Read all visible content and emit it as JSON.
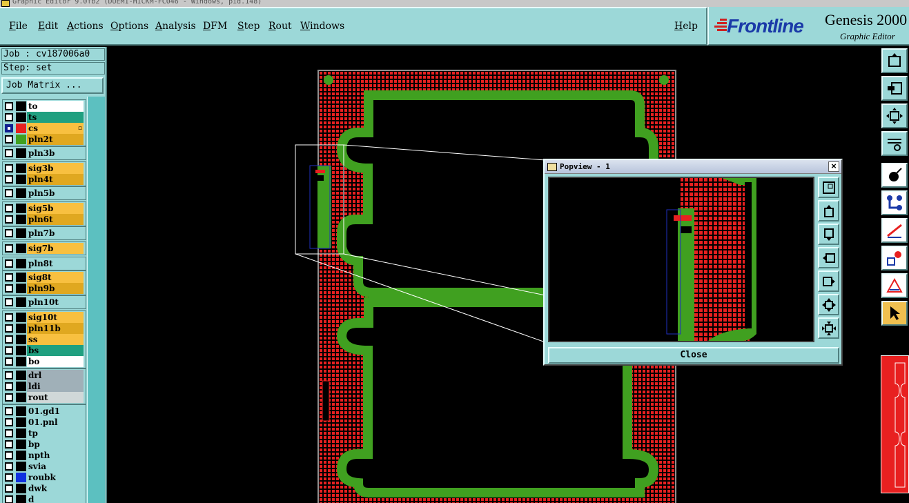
{
  "title_bar": {
    "text": "Graphic Editor 9.0fb2 (DUEM1-HICKM-FC046 - Windows, pid.148)"
  },
  "menu": {
    "items": [
      "File",
      "Edit",
      "Actions",
      "Options",
      "Analysis",
      "DFM",
      "Step",
      "Rout",
      "Windows"
    ],
    "help": "Help"
  },
  "branding": {
    "logo": "Frontline",
    "product": "Genesis 2000",
    "subtitle": "Graphic Editor"
  },
  "job": {
    "job_label": "Job : cv187006a0",
    "step_label": "Step: set",
    "matrix_button": "Job Matrix ..."
  },
  "layers": [
    {
      "name": "to",
      "color": "#ffffff",
      "swatch": "#000000",
      "checked": false
    },
    {
      "name": "ts",
      "color": "#20a080",
      "swatch": "#000000",
      "checked": false
    },
    {
      "name": "cs",
      "color": "#f8c040",
      "swatch": "#e82020",
      "checked": true,
      "marker": "▫"
    },
    {
      "name": "pln2t",
      "color": "#e0a820",
      "swatch": "#40a020",
      "checked": false
    },
    {
      "name": "pln3b",
      "color": "#9cd8d8",
      "swatch": "#000000",
      "checked": false
    },
    {
      "name": "sig3b",
      "color": "#f8c040",
      "swatch": "#000000",
      "checked": false
    },
    {
      "name": "pln4t",
      "color": "#e0a820",
      "swatch": "#000000",
      "checked": false
    },
    {
      "name": "pln5b",
      "color": "#9cd8d8",
      "swatch": "#000000",
      "checked": false
    },
    {
      "name": "sig5b",
      "color": "#f8c040",
      "swatch": "#000000",
      "checked": false
    },
    {
      "name": "pln6t",
      "color": "#e0a820",
      "swatch": "#000000",
      "checked": false
    },
    {
      "name": "pln7b",
      "color": "#9cd8d8",
      "swatch": "#000000",
      "checked": false
    },
    {
      "name": "sig7b",
      "color": "#f8c040",
      "swatch": "#000000",
      "checked": false
    },
    {
      "name": "pln8t",
      "color": "#9cd8d8",
      "swatch": "#000000",
      "checked": false
    },
    {
      "name": "sig8t",
      "color": "#f8c040",
      "swatch": "#000000",
      "checked": false
    },
    {
      "name": "pln9b",
      "color": "#e0a820",
      "swatch": "#000000",
      "checked": false
    },
    {
      "name": "pln10t",
      "color": "#9cd8d8",
      "swatch": "#000000",
      "checked": false
    },
    {
      "name": "sig10t",
      "color": "#f8c040",
      "swatch": "#000000",
      "checked": false
    },
    {
      "name": "pln11b",
      "color": "#e0a820",
      "swatch": "#000000",
      "checked": false
    },
    {
      "name": "ss",
      "color": "#f8c040",
      "swatch": "#000000",
      "checked": false
    },
    {
      "name": "bs",
      "color": "#20a080",
      "swatch": "#000000",
      "checked": false
    },
    {
      "name": "bo",
      "color": "#ffffff",
      "swatch": "#000000",
      "checked": false
    },
    {
      "name": "drl",
      "color": "#a0b0b8",
      "swatch": "#000000",
      "checked": false
    },
    {
      "name": "ldi",
      "color": "#a0b0b8",
      "swatch": "#000000",
      "checked": false
    },
    {
      "name": "rout",
      "color": "#d0d8d8",
      "swatch": "#000000",
      "checked": false
    },
    {
      "name": "01.gd1",
      "color": "#9cd8d8",
      "swatch": "#000000",
      "checked": false
    },
    {
      "name": "01.pnl",
      "color": "#9cd8d8",
      "swatch": "#000000",
      "checked": false
    },
    {
      "name": "tp",
      "color": "#9cd8d8",
      "swatch": "#000000",
      "checked": false
    },
    {
      "name": "bp",
      "color": "#9cd8d8",
      "swatch": "#000000",
      "checked": false
    },
    {
      "name": "npth",
      "color": "#9cd8d8",
      "swatch": "#000000",
      "checked": false
    },
    {
      "name": "svia",
      "color": "#9cd8d8",
      "swatch": "#000000",
      "checked": false
    },
    {
      "name": "roubk",
      "color": "#9cd8d8",
      "swatch": "#1030e0",
      "checked": false
    },
    {
      "name": "dwk",
      "color": "#9cd8d8",
      "swatch": "#000000",
      "checked": false
    },
    {
      "name": "d",
      "color": "#9cd8d8",
      "swatch": "#000000",
      "checked": false
    }
  ],
  "popview": {
    "title": "Popview - 1",
    "close_label": "Close"
  },
  "colors": {
    "panel": "#9cd8d8",
    "copper": "#e82020",
    "profile": "#40a020",
    "accent": "#1a3aa8"
  },
  "toolbar_icons": [
    "snapshot-icon",
    "zoom-back-icon",
    "fit-screen-icon",
    "measure-icon",
    "feature-select-icon",
    "net-icon",
    "line-tool-icon",
    "pad-tool-icon",
    "warning-icon",
    "pointer-icon"
  ],
  "popview_icons": [
    "zoom-window-icon",
    "pan-up-icon",
    "pan-down-icon",
    "pan-left-icon",
    "pan-right-icon",
    "zoom-in-icon",
    "zoom-out-icon"
  ]
}
